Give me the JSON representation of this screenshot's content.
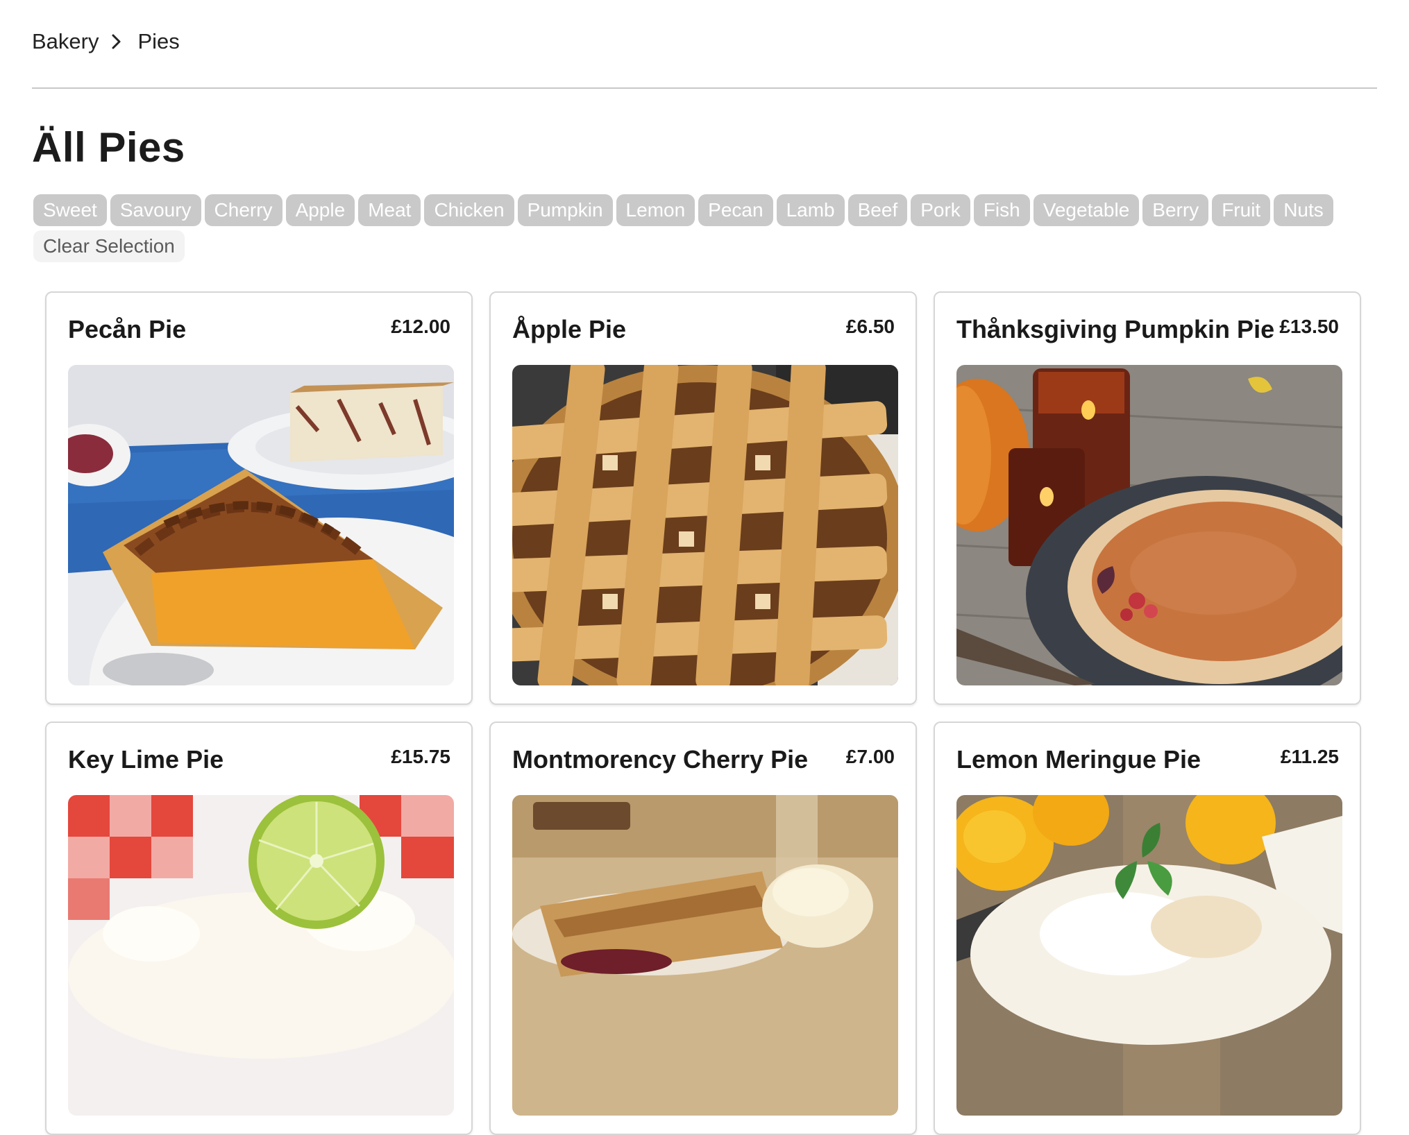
{
  "breadcrumb": {
    "items": [
      "Bakery",
      "Pies"
    ]
  },
  "page_title": "Äll Pies",
  "filters": {
    "tags": [
      "Sweet",
      "Savoury",
      "Cherry",
      "Apple",
      "Meat",
      "Chicken",
      "Pumpkin",
      "Lemon",
      "Pecan",
      "Lamb",
      "Beef",
      "Pork",
      "Fish",
      "Vegetable",
      "Berry",
      "Fruit",
      "Nuts"
    ],
    "clear_label": "Clear Selection"
  },
  "products": [
    {
      "name": "Pecån Pie",
      "price": "£12.00",
      "image": "pecan-pie-photo"
    },
    {
      "name": "Åpple Pie",
      "price": "£6.50",
      "image": "apple-pie-photo"
    },
    {
      "name": "Thånksgiving Pumpkin Pie",
      "price": "£13.50",
      "image": "pumpkin-pie-photo"
    },
    {
      "name": "Key Lime Pie",
      "price": "£15.75",
      "image": "key-lime-pie-photo"
    },
    {
      "name": "Montmorency Cherry Pie",
      "price": "£7.00",
      "image": "cherry-pie-photo"
    },
    {
      "name": "Lemon Meringue Pie",
      "price": "£11.25",
      "image": "lemon-meringue-pie-photo"
    }
  ],
  "colors": {
    "chip_bg": "#c9c9c9",
    "chip_text": "#ffffff",
    "card_border": "#d6d6d6",
    "divider": "#c8c8c8"
  }
}
